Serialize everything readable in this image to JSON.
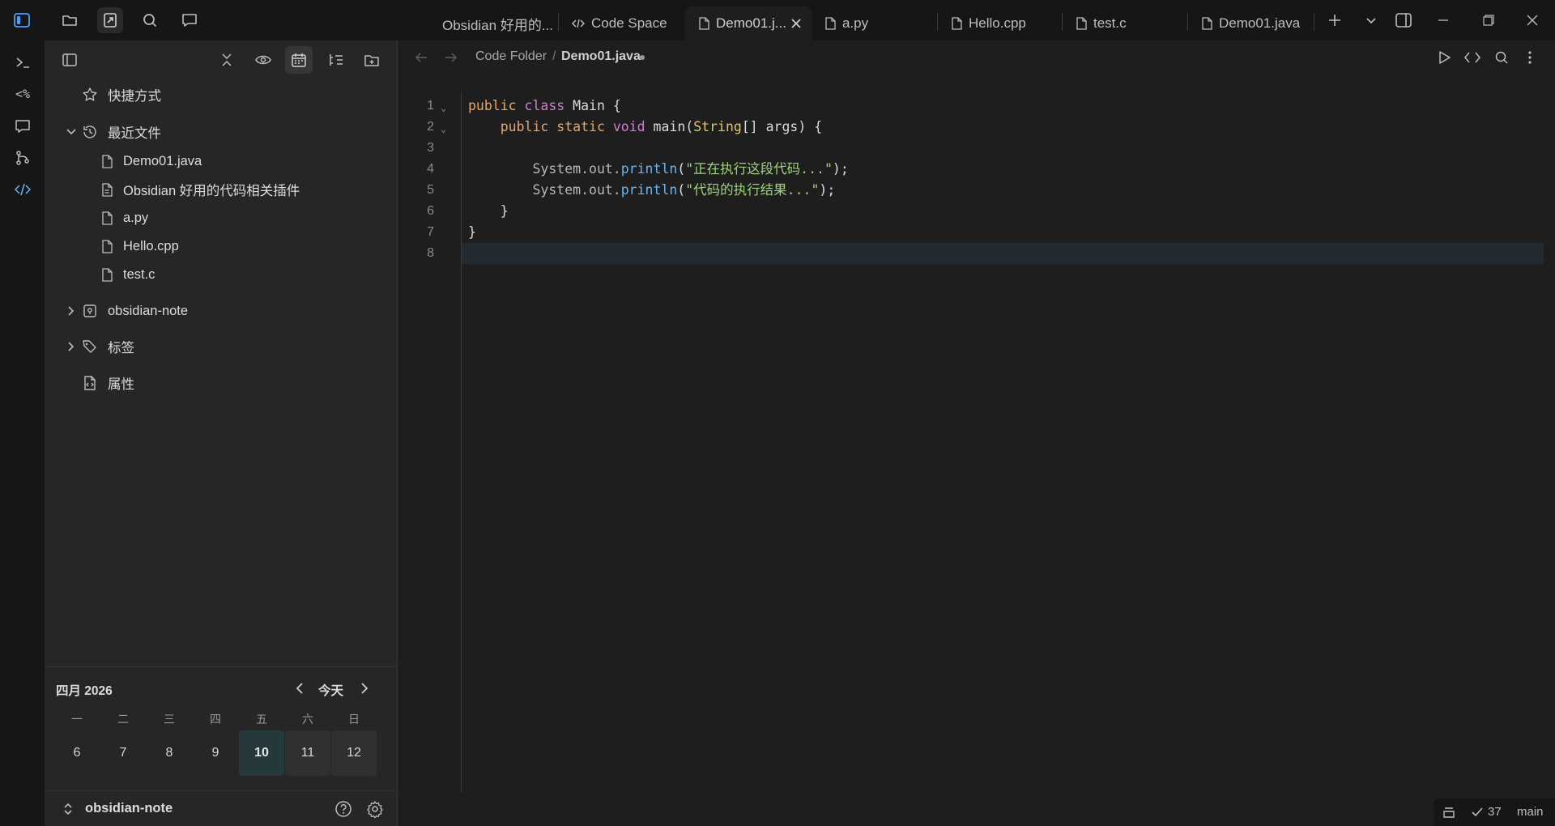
{
  "topbar": {
    "tabs": [
      {
        "label": "Obsidian 好用的...",
        "icon": "none"
      },
      {
        "label": "Code Space",
        "icon": "code-icon"
      },
      {
        "label": "Demo01.j...",
        "icon": "file-icon",
        "active": true
      },
      {
        "label": "a.py",
        "icon": "file-icon"
      },
      {
        "label": "Hello.cpp",
        "icon": "file-icon"
      },
      {
        "label": "test.c",
        "icon": "file-icon"
      },
      {
        "label": "Demo01.java",
        "icon": "file-icon"
      }
    ]
  },
  "sidebar": {
    "bookmarks_label": "快捷方式",
    "recent_label": "最近文件",
    "recent_files": [
      "Demo01.java",
      "Obsidian 好用的代码相关插件",
      "a.py",
      "Hello.cpp",
      "test.c"
    ],
    "vault_folder_label": "obsidian-note",
    "tags_label": "标签",
    "properties_label": "属性"
  },
  "calendar": {
    "month_title": "四月 2026",
    "today_label": "今天",
    "weekdays": [
      "一",
      "二",
      "三",
      "四",
      "五",
      "六",
      "日"
    ],
    "days": [
      "6",
      "7",
      "8",
      "9",
      "10",
      "11",
      "12"
    ],
    "today_index": 4
  },
  "vault": {
    "name": "obsidian-note"
  },
  "editor": {
    "breadcrumb_folder": "Code Folder",
    "breadcrumb_sep": "/",
    "breadcrumb_file": "Demo01.java",
    "line_numbers": [
      "1",
      "2",
      "3",
      "4",
      "5",
      "6",
      "7",
      "8"
    ],
    "code": {
      "l1": [
        "public",
        " ",
        "class",
        " Main {"
      ],
      "l2": [
        "    ",
        "public",
        " ",
        "static",
        " ",
        "void",
        " main(",
        "String",
        "[] args) {"
      ],
      "l4": [
        "        System.out.",
        "println",
        "(",
        "\"正在执行这段代码...\"",
        ");"
      ],
      "l5": [
        "        System.out.",
        "println",
        "(",
        "\"代码的执行结果...\"",
        ");"
      ],
      "l6": "    }",
      "l7": "}"
    }
  },
  "statusbar": {
    "count": "37",
    "branch": "main"
  },
  "colors": {
    "accent": "#4a9eff",
    "today_bg": "#25393a",
    "keyword": "#d67bd6",
    "string": "#9ed37b",
    "method": "#6cb3f0"
  }
}
